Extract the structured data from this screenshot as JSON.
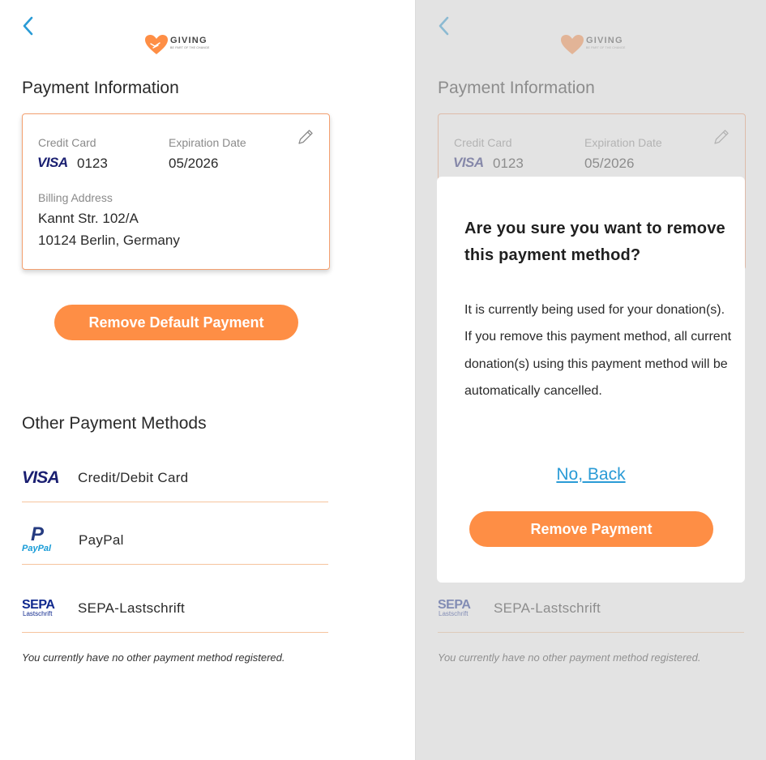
{
  "brand": {
    "name": "GIVING",
    "tagline": "BE PART OF THE CHANGE"
  },
  "payment_info": {
    "title": "Payment Information",
    "card": {
      "type_label": "Credit Card",
      "brand": "VISA",
      "last4": "0123",
      "expiry_label": "Expiration Date",
      "expiry": "05/2026",
      "billing_label": "Billing Address",
      "address_line1": "Kannt Str. 102/A",
      "address_line2": "10124 Berlin, Germany"
    },
    "remove_default_label": "Remove Default Payment"
  },
  "other_methods": {
    "title": "Other Payment Methods",
    "items": [
      {
        "logo": "VISA",
        "label": "Credit/Debit Card"
      },
      {
        "logo_top": "P",
        "logo_bottom": "PayPal",
        "label": "PayPal"
      },
      {
        "logo_top": "SEPA",
        "logo_bottom": "Lastschrift",
        "label": "SEPA-Lastschrift"
      }
    ],
    "note": "You currently have no other payment method registered."
  },
  "modal": {
    "title": "Are you sure you want to remove this payment method?",
    "body_line1": "It is currently being used for your donation(s).",
    "body_line2": "If you remove this payment method, all current donation(s) using this payment method will be automatically cancelled.",
    "back_label": "No, Back",
    "confirm_label": "Remove Payment"
  },
  "colors": {
    "accent": "#fe8e45",
    "link": "#2a9bd6",
    "card_border": "#f4a070",
    "visa_blue": "#1a1f71"
  },
  "icons": [
    "back-chevron-icon",
    "heart-hands-logo-icon",
    "pencil-edit-icon",
    "visa-logo-icon",
    "paypal-logo-icon",
    "sepa-logo-icon"
  ]
}
